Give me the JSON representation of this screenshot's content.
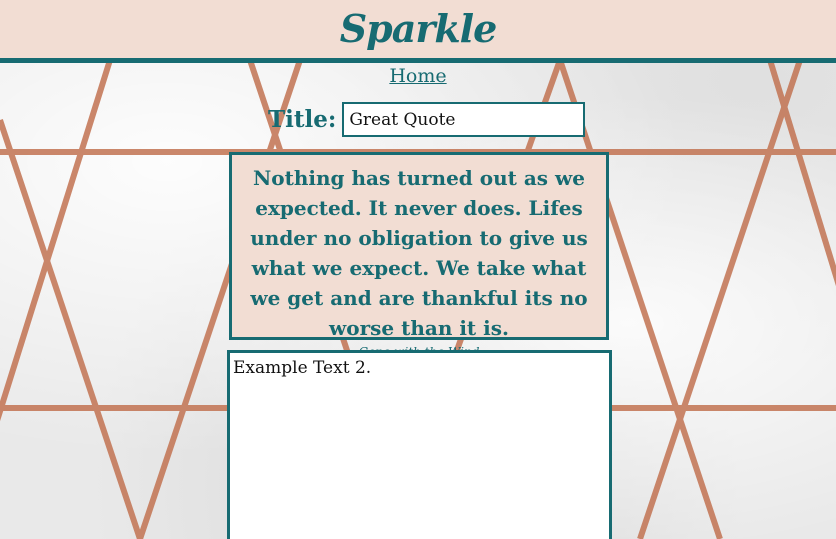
{
  "header": {
    "brand": "Sparkle"
  },
  "nav": {
    "home_label": "Home"
  },
  "form": {
    "title_label": "Title:",
    "title_value": "Great Quote"
  },
  "quote": {
    "text": "Nothing has turned out as we expected. It never does. Lifes under no obligation to give us what we expect. We take what we get and are thankful its no worse than it is.",
    "source": "Gone with the Wind"
  },
  "editor": {
    "text": "Example Text 2."
  },
  "colors": {
    "accent": "#176b72",
    "header_bg": "#f2ddd3",
    "rose_gold": "#c0714f"
  }
}
